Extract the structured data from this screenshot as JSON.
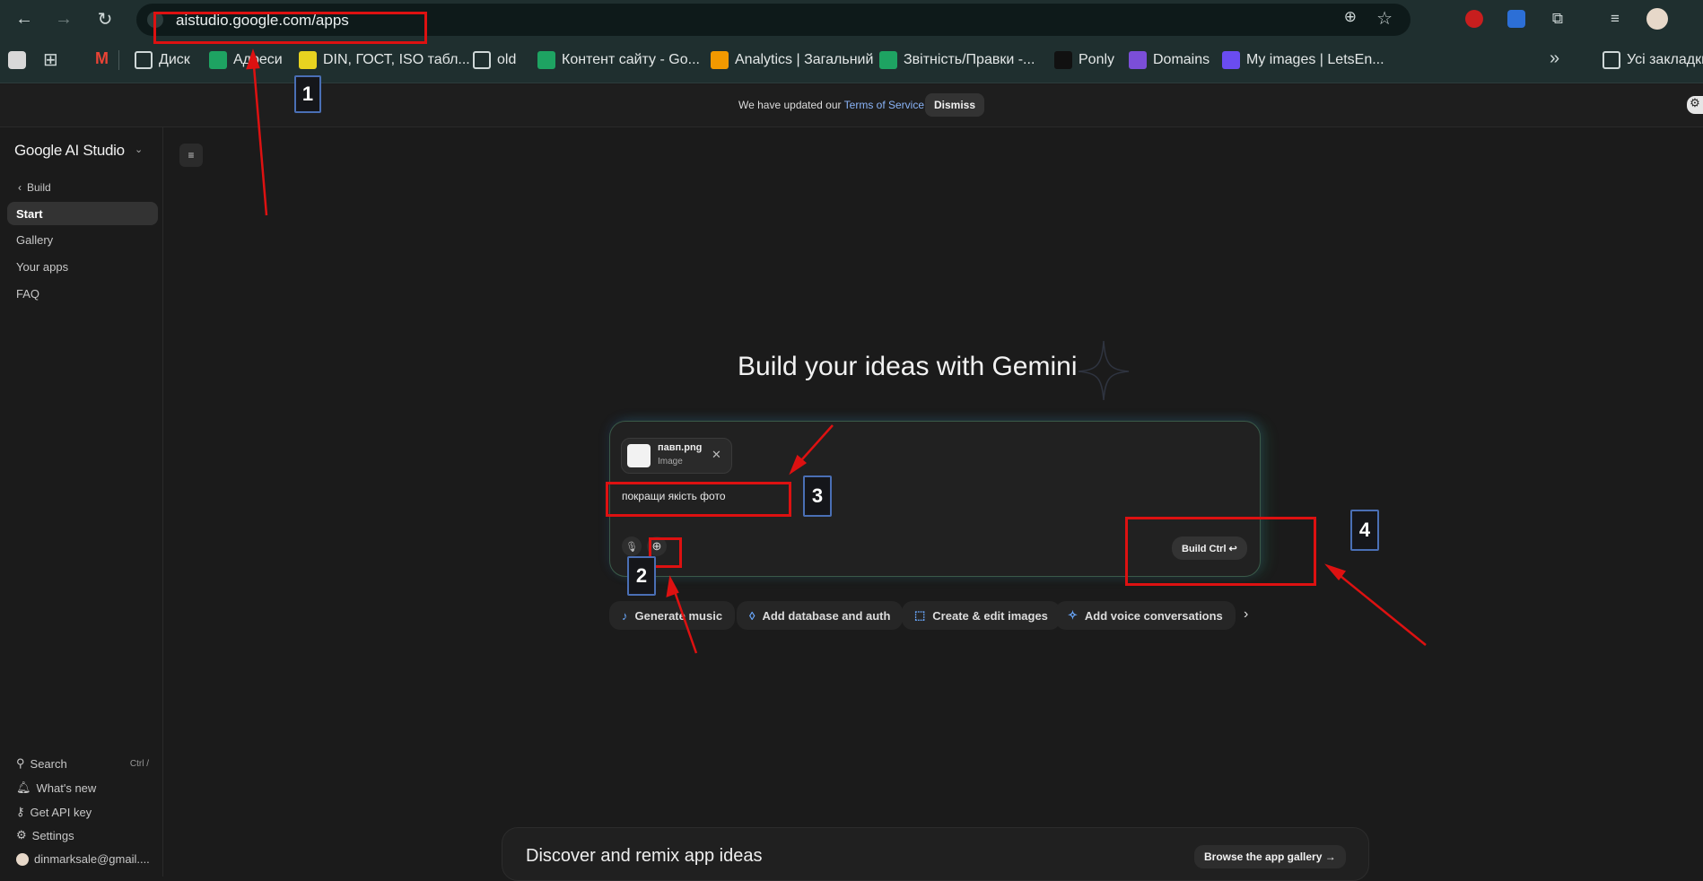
{
  "browser": {
    "url": "aistudio.google.com/apps",
    "bookmarks": [
      {
        "label": "Диск",
        "color": "#cfd8d8",
        "icon": "folder-icon"
      },
      {
        "label": "Адреси",
        "color": "#1ea362",
        "icon": "sheets-icon"
      },
      {
        "label": "DIN, ГОСТ, ISO табл...",
        "color": "#e8d320",
        "icon": "document-icon"
      },
      {
        "label": "old",
        "color": "#cfd8d8",
        "icon": "folder-icon"
      },
      {
        "label": "Контент сайту - Go...",
        "color": "#1ea362",
        "icon": "sheets-icon"
      },
      {
        "label": "Analytics | Загальний",
        "color": "#f29900",
        "icon": "analytics-icon"
      },
      {
        "label": "Звітність/Правки -...",
        "color": "#1ea362",
        "icon": "sheets-icon"
      },
      {
        "label": "Ponly",
        "color": "#111111",
        "icon": "ponly-icon"
      },
      {
        "label": "Domains",
        "color": "#7b4ed8",
        "icon": "domains-icon"
      },
      {
        "label": "My images | LetsEn...",
        "color": "#6a4cf0",
        "icon": "letsenhance-icon"
      }
    ],
    "all_bookmarks": "Усі закладки",
    "more_glyph": "»"
  },
  "tos_banner": {
    "prefix": "We have updated our ",
    "link": "Terms of Service",
    "dismiss": "Dismiss"
  },
  "sidebar": {
    "brand": "Google AI Studio",
    "back_label": "Build",
    "items": [
      {
        "label": "Start"
      },
      {
        "label": "Gallery"
      },
      {
        "label": "Your apps"
      },
      {
        "label": "FAQ"
      }
    ],
    "bottom": {
      "search": "Search",
      "search_shortcut": "Ctrl /",
      "whats_new": "What's new",
      "api_key": "Get API key",
      "settings": "Settings",
      "account": "dinmarksale@gmail...."
    }
  },
  "main": {
    "heading": "Build your ideas with Gemini",
    "attachment": {
      "name": "павп.png",
      "type": "Image"
    },
    "prompt_text": "покращи якість фото",
    "build_button": "Build Ctrl ↩",
    "chips": [
      {
        "label": "Generate music",
        "icon": "music-note-icon"
      },
      {
        "label": "Add database and auth",
        "icon": "firebase-icon"
      },
      {
        "label": "Create & edit images",
        "icon": "image-edit-icon"
      },
      {
        "label": "Add voice conversations",
        "icon": "voice-sparkle-icon"
      }
    ],
    "discover_title": "Discover and remix app ideas",
    "gallery_button": "Browse the app gallery →"
  },
  "annotations": {
    "labels": [
      "1",
      "2",
      "3",
      "4"
    ],
    "color": "#dd1111"
  }
}
